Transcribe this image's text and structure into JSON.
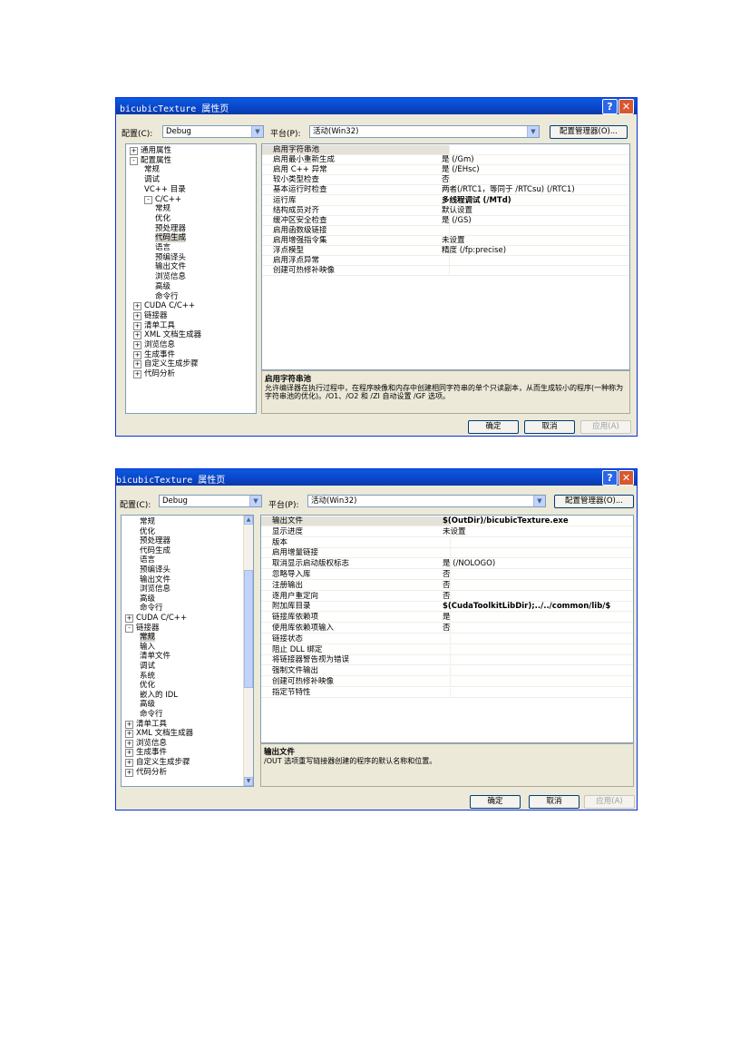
{
  "dialog1": {
    "title": "bicubicTexture 属性页",
    "config_label": "配置(C):",
    "config_value": "Debug",
    "platform_label": "平台(P):",
    "platform_value": "活动(Win32)",
    "config_manager": "配置管理器(O)...",
    "tree": [
      {
        "label": "通用属性",
        "exp": "+"
      },
      {
        "label": "配置属性",
        "exp": "-"
      },
      {
        "label": "常规"
      },
      {
        "label": "调试"
      },
      {
        "label": "VC++ 目录"
      },
      {
        "label": "C/C++",
        "exp": "-"
      },
      {
        "label": "常规"
      },
      {
        "label": "优化"
      },
      {
        "label": "预处理器"
      },
      {
        "label": "代码生成",
        "selected": true
      },
      {
        "label": "语言"
      },
      {
        "label": "预编译头"
      },
      {
        "label": "输出文件"
      },
      {
        "label": "浏览信息"
      },
      {
        "label": "高级"
      },
      {
        "label": "命令行"
      },
      {
        "label": "CUDA C/C++",
        "exp": "+"
      },
      {
        "label": "链接器",
        "exp": "+"
      },
      {
        "label": "清单工具",
        "exp": "+"
      },
      {
        "label": "XML 文档生成器",
        "exp": "+"
      },
      {
        "label": "浏览信息",
        "exp": "+"
      },
      {
        "label": "生成事件",
        "exp": "+"
      },
      {
        "label": "自定义生成步骤",
        "exp": "+"
      },
      {
        "label": "代码分析",
        "exp": "+"
      }
    ],
    "properties": [
      {
        "name": "启用字符串池",
        "value": ""
      },
      {
        "name": "启用最小重新生成",
        "value": "是 (/Gm)"
      },
      {
        "name": "启用 C++ 异常",
        "value": "是 (/EHsc)"
      },
      {
        "name": "较小类型检查",
        "value": "否"
      },
      {
        "name": "基本运行时检查",
        "value": "两者(/RTC1，等同于 /RTCsu) (/RTC1)"
      },
      {
        "name": "运行库",
        "value": "多线程调试 (/MTd)",
        "bold": true
      },
      {
        "name": "结构成员对齐",
        "value": "默认设置"
      },
      {
        "name": "缓冲区安全检查",
        "value": "是 (/GS)"
      },
      {
        "name": "启用函数级链接",
        "value": ""
      },
      {
        "name": "启用增强指令集",
        "value": "未设置"
      },
      {
        "name": "浮点模型",
        "value": "精度 (/fp:precise)"
      },
      {
        "name": "启用浮点异常",
        "value": ""
      },
      {
        "name": "创建可热修补映像",
        "value": ""
      }
    ],
    "desc_title": "启用字符串池",
    "desc_text": "允许编译器在执行过程中，在程序映像和内存中创建相同字符串的单个只读副本，从而生成较小的程序(一种称为字符串池的优化)。/O1、/O2 和 /ZI 自动设置 /GF 选项。",
    "ok": "确定",
    "cancel": "取消",
    "apply": "应用(A)"
  },
  "dialog2": {
    "title": "bicubicTexture 属性页",
    "config_label": "配置(C):",
    "config_value": "Debug",
    "platform_label": "平台(P):",
    "platform_value": "活动(Win32)",
    "config_manager": "配置管理器(O)...",
    "tree": [
      {
        "label": "常规"
      },
      {
        "label": "优化"
      },
      {
        "label": "预处理器"
      },
      {
        "label": "代码生成"
      },
      {
        "label": "语言"
      },
      {
        "label": "预编译头"
      },
      {
        "label": "输出文件"
      },
      {
        "label": "浏览信息"
      },
      {
        "label": "高级"
      },
      {
        "label": "命令行"
      },
      {
        "label": "CUDA C/C++",
        "exp": "+"
      },
      {
        "label": "链接器",
        "exp": "-"
      },
      {
        "label": "常规",
        "selected": true
      },
      {
        "label": "输入"
      },
      {
        "label": "清单文件"
      },
      {
        "label": "调试"
      },
      {
        "label": "系统"
      },
      {
        "label": "优化"
      },
      {
        "label": "嵌入的 IDL"
      },
      {
        "label": "高级"
      },
      {
        "label": "命令行"
      },
      {
        "label": "清单工具",
        "exp": "+"
      },
      {
        "label": "XML 文档生成器",
        "exp": "+"
      },
      {
        "label": "浏览信息",
        "exp": "+"
      },
      {
        "label": "生成事件",
        "exp": "+"
      },
      {
        "label": "自定义生成步骤",
        "exp": "+"
      },
      {
        "label": "代码分析",
        "exp": "+"
      }
    ],
    "properties": [
      {
        "name": "输出文件",
        "value": "$(OutDir)/bicubicTexture.exe",
        "bold": true
      },
      {
        "name": "显示进度",
        "value": "未设置"
      },
      {
        "name": "版本",
        "value": ""
      },
      {
        "name": "启用增量链接",
        "value": ""
      },
      {
        "name": "取消显示启动版权标志",
        "value": "是 (/NOLOGO)"
      },
      {
        "name": "忽略导入库",
        "value": "否"
      },
      {
        "name": "注册输出",
        "value": "否"
      },
      {
        "name": "逐用户重定向",
        "value": "否"
      },
      {
        "name": "附加库目录",
        "value": "$(CudaToolkitLibDir);../../common/lib/$",
        "bold": true
      },
      {
        "name": "链接库依赖项",
        "value": "是"
      },
      {
        "name": "使用库依赖项输入",
        "value": "否"
      },
      {
        "name": "链接状态",
        "value": ""
      },
      {
        "name": "阻止 DLL 绑定",
        "value": ""
      },
      {
        "name": "将链接器警告视为错误",
        "value": ""
      },
      {
        "name": "强制文件输出",
        "value": ""
      },
      {
        "name": "创建可热修补映像",
        "value": ""
      },
      {
        "name": "指定节特性",
        "value": ""
      }
    ],
    "desc_title": "输出文件",
    "desc_text": "/OUT 选项重写链接器创建的程序的默认名称和位置。",
    "ok": "确定",
    "cancel": "取消",
    "apply": "应用(A)"
  },
  "icons": {
    "help": "?",
    "close": "✕",
    "dropdown": "▼",
    "scroll_up": "▲",
    "scroll_down": "▼"
  }
}
